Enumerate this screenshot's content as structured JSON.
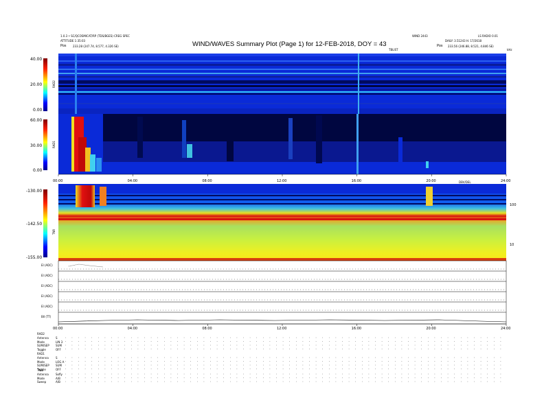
{
  "header": {
    "title": "WIND/WAVES Summary Plot (Page 1) for 12-FEB-2018, DOY = 43",
    "left_line1": "1.0.3 • SC/QCOSMICAT/RP (TDS/BGES) CREG SPEC",
    "left_line2": "ATTITUDE 1:35:03",
    "left_pos_label": "Pos",
    "left_pos_value": "233.28 (247.74, 8.577, 4.326 SE)",
    "right_top_1": "WIND 2443",
    "right_top_2": "LS RADIO 0.01",
    "right_line2": "DAILY: 3.51243 H. 17/2618",
    "right_pos_label": "Pos",
    "right_pos_value": "233.56 (246.88, 8.521, 4.846 SE)",
    "tbl_label": "TBLIST",
    "khz_label": "kHz"
  },
  "panels": {
    "rad2": {
      "name": "RAD2",
      "ticks": [
        "40.00",
        "20.00",
        "0.00"
      ]
    },
    "rad1": {
      "name": "RAD1",
      "ticks": [
        "60.00",
        "30.00",
        "0.00"
      ]
    },
    "tnr": {
      "name": "TNR",
      "ticks": [
        "-130.00",
        "-142.50",
        "-155.00"
      ],
      "right_ticks": [
        "100",
        "10"
      ],
      "right_label": "DBV/DEL"
    },
    "waves": {
      "labels": [
        "ΕΙ (ADC)",
        "ΕΙ (ADC)",
        "ΕΙ (ADC)",
        "ΕΙ (ADC)",
        "ΕΙ (ADC)",
        "ΒΙΙ (TT)"
      ]
    }
  },
  "time_axis": {
    "top": [
      "00:00",
      "04:00",
      "08:00",
      "12:00",
      "16:00",
      "20:00",
      "24:00"
    ],
    "bottom": [
      "00:00",
      "04:00",
      "08:00",
      "12:00",
      "16:00",
      "20:00",
      "24:00"
    ]
  },
  "settings": {
    "rad2_header": "RAD2",
    "rad2_rows": [
      {
        "label": "Antenna",
        "value": "S"
      },
      {
        "label": "Mode",
        "value": "LIN 3"
      },
      {
        "label": "SUM/SEP",
        "value": "SUM"
      },
      {
        "label": "Toggle",
        "value": "OFF"
      }
    ],
    "rad1_header": "RAD1",
    "rad1_rows": [
      {
        "label": "Antenna",
        "value": "S"
      },
      {
        "label": "Mode",
        "value": "LOG A"
      },
      {
        "label": "SUM/SEP",
        "value": "SUM"
      },
      {
        "label": "Toggle",
        "value": "OFF"
      }
    ],
    "tnr_header": "TNR",
    "tnr_rows": [
      {
        "label": "Antenna",
        "value": "Sofly"
      },
      {
        "label": "Mode",
        "value": "A/B"
      },
      {
        "label": "Sweep",
        "value": "A/B"
      }
    ]
  },
  "colors": {
    "background": "#0a2ad8",
    "dark_band": "#000640",
    "burst_red": "#e01010",
    "burst_yellow": "#f8e020",
    "tnr_green": "#9ae060",
    "tnr_yellow": "#e8f030",
    "tnr_red": "#d81010"
  },
  "chart_data": {
    "type": "heatmap",
    "title": "WIND/WAVES Summary Plot (Page 1) for 12-FEB-2018, DOY = 43",
    "x": [
      "00:00",
      "04:00",
      "08:00",
      "12:00",
      "16:00",
      "20:00",
      "24:00"
    ],
    "series": [
      {
        "name": "RAD2",
        "ylim": [
          0,
          40
        ],
        "yticks": [
          0,
          20,
          40
        ]
      },
      {
        "name": "RAD1",
        "ylim": [
          0,
          60
        ],
        "yticks": [
          0,
          30,
          60
        ]
      },
      {
        "name": "TNR",
        "ylim": [
          -155,
          -130
        ],
        "yticks": [
          -155,
          -142.5,
          -130
        ]
      }
    ],
    "colorbar": "jet"
  }
}
